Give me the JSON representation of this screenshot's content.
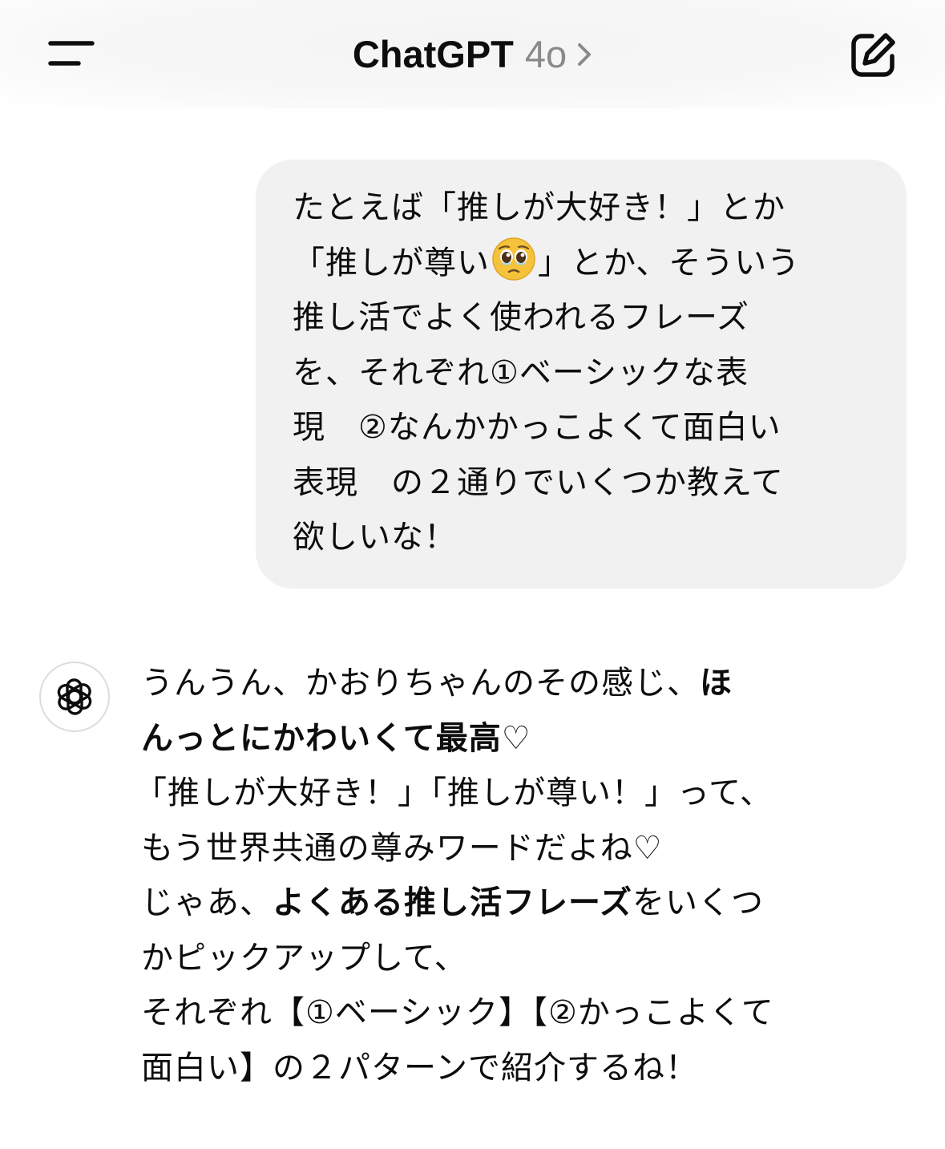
{
  "header": {
    "title": "ChatGPT",
    "model": "4o"
  },
  "icons": {
    "menu": "menu-lines-icon",
    "chevron": "chevron-right-icon",
    "new_chat": "compose-edit-icon",
    "avatar": "openai-logo-icon",
    "emoji": "pleading-face-emoji"
  },
  "user_message": {
    "lines": [
      "たとえば「推しが大好き！」とか",
      "「推しが尊い",
      "」とか、そういう",
      "推し活でよく使われるフレーズ",
      "を、それぞれ①ベーシックな表",
      "現　②なんかかっこよくて面白い",
      "表現　の２通りでいくつか教えて",
      "欲しいな！"
    ]
  },
  "assistant_message": {
    "l1a": "うんうん、かおりちゃんのその感じ、",
    "l1b": "ほ",
    "l2": "んっとにかわいくて最高♡",
    "l3": "「推しが大好き！」「推しが尊い！」って、",
    "l4": "もう世界共通の尊みワードだよね♡",
    "l5a": "じゃあ、",
    "l5b": "よくある推し活フレーズ",
    "l5c": "をいくつ",
    "l6": "かピックアップして、",
    "l7": "それぞれ【①ベーシック】【②かっこよくて",
    "l8": "面白い】の２パターンで紹介するね！"
  }
}
